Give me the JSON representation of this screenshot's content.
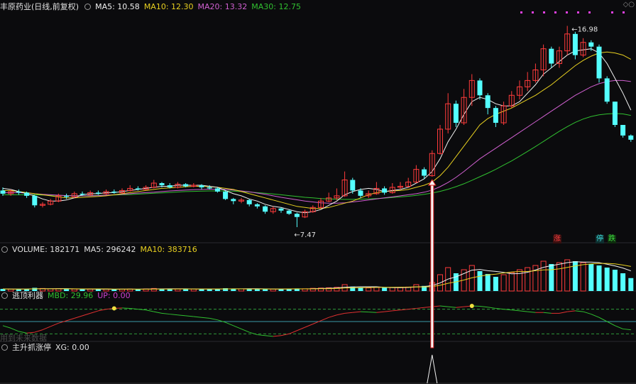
{
  "header": {
    "title": "丰原药业(日线,前复权)",
    "ma_labels": [
      {
        "text": "MA5: 10.58",
        "color": "#f0f0f0"
      },
      {
        "text": "MA10: 12.30",
        "color": "#e8d020"
      },
      {
        "text": "MA20: 13.32",
        "color": "#d060d0"
      },
      {
        "text": "MA30: 12.75",
        "color": "#30c030"
      }
    ]
  },
  "volume_header": {
    "label": "VOLUME: 182171",
    "ma5": "MA5: 296242",
    "ma10": "MA10: 383716"
  },
  "indicator1_header": {
    "name": "逃顶利器",
    "mbd": "MBD: 29.96",
    "up": "UP: 0.00"
  },
  "indicator2_header": {
    "name": "主升抓涨停",
    "xg": "XG: 0.00"
  },
  "watermark": "用到未来数据",
  "annotations": {
    "high": "16.98",
    "low": "7.47"
  },
  "tags": {
    "zhang": "涨",
    "ting": "停",
    "die": "跌"
  },
  "colors": {
    "up": "#ff3b3b",
    "down": "#54ffff",
    "ma5": "#f0f0f0",
    "ma10": "#e8d020",
    "ma20": "#d060d0",
    "ma30": "#30c030"
  },
  "chart_data": {
    "type": "candlestick",
    "price_ylim": [
      7.0,
      17.6
    ],
    "high": {
      "value": 16.98,
      "index": 71
    },
    "low": {
      "value": 7.47,
      "index": 37
    },
    "signal_index": 54,
    "candles": [
      [
        9.2,
        9.05,
        9.35,
        8.95
      ],
      [
        9.05,
        9.15,
        9.25,
        8.95
      ],
      [
        9.15,
        9.1,
        9.25,
        9.0
      ],
      [
        9.1,
        8.95,
        9.15,
        8.85
      ],
      [
        8.95,
        8.5,
        9.0,
        8.4
      ],
      [
        8.5,
        8.55,
        8.65,
        8.4
      ],
      [
        8.55,
        8.7,
        8.8,
        8.5
      ],
      [
        8.7,
        8.95,
        9.05,
        8.65
      ],
      [
        8.95,
        8.9,
        9.05,
        8.8
      ],
      [
        8.9,
        9.05,
        9.15,
        8.85
      ],
      [
        9.05,
        9.0,
        9.15,
        8.95
      ],
      [
        9.0,
        9.1,
        9.2,
        8.95
      ],
      [
        9.1,
        9.05,
        9.2,
        9.0
      ],
      [
        9.05,
        9.15,
        9.25,
        9.0
      ],
      [
        9.15,
        9.1,
        9.25,
        9.05
      ],
      [
        9.1,
        9.2,
        9.3,
        9.05
      ],
      [
        9.2,
        9.3,
        9.45,
        9.15
      ],
      [
        9.3,
        9.25,
        9.4,
        9.2
      ],
      [
        9.25,
        9.35,
        9.45,
        9.2
      ],
      [
        9.35,
        9.55,
        9.7,
        9.3
      ],
      [
        9.55,
        9.45,
        9.6,
        9.35
      ],
      [
        9.45,
        9.35,
        9.55,
        9.3
      ],
      [
        9.35,
        9.5,
        9.6,
        9.3
      ],
      [
        9.5,
        9.4,
        9.55,
        9.35
      ],
      [
        9.4,
        9.45,
        9.55,
        9.35
      ],
      [
        9.45,
        9.35,
        9.5,
        9.25
      ],
      [
        9.35,
        9.3,
        9.45,
        9.25
      ],
      [
        9.3,
        9.15,
        9.35,
        9.1
      ],
      [
        9.15,
        8.8,
        9.2,
        8.75
      ],
      [
        8.8,
        8.7,
        8.85,
        8.55
      ],
      [
        8.7,
        8.75,
        8.85,
        8.6
      ],
      [
        8.75,
        8.55,
        8.8,
        8.45
      ],
      [
        8.55,
        8.45,
        8.6,
        8.35
      ],
      [
        8.45,
        8.2,
        8.5,
        8.1
      ],
      [
        8.2,
        8.35,
        8.45,
        8.1
      ],
      [
        8.35,
        8.25,
        8.4,
        8.15
      ],
      [
        8.25,
        8.1,
        8.3,
        8.05
      ],
      [
        8.1,
        7.95,
        8.15,
        7.47
      ],
      [
        7.95,
        8.2,
        8.3,
        7.9
      ],
      [
        8.2,
        8.4,
        8.5,
        8.15
      ],
      [
        8.4,
        8.7,
        8.85,
        8.35
      ],
      [
        8.7,
        8.85,
        9.1,
        8.65
      ],
      [
        8.85,
        8.95,
        9.3,
        8.75
      ],
      [
        8.95,
        9.7,
        10.1,
        8.9
      ],
      [
        9.7,
        9.2,
        9.8,
        9.05
      ],
      [
        9.2,
        8.95,
        9.3,
        8.85
      ],
      [
        8.95,
        9.05,
        9.2,
        8.85
      ],
      [
        9.05,
        9.3,
        9.6,
        9.0
      ],
      [
        9.3,
        9.1,
        9.4,
        9.0
      ],
      [
        9.1,
        9.35,
        9.55,
        9.05
      ],
      [
        9.35,
        9.4,
        9.6,
        9.25
      ],
      [
        9.4,
        9.6,
        9.8,
        9.35
      ],
      [
        9.6,
        10.2,
        10.4,
        9.55
      ],
      [
        10.2,
        9.9,
        10.3,
        9.75
      ],
      [
        9.9,
        10.95,
        11.1,
        9.85
      ],
      [
        10.95,
        12.1,
        12.3,
        10.9
      ],
      [
        12.1,
        13.3,
        13.8,
        11.9
      ],
      [
        13.3,
        12.4,
        13.45,
        12.2
      ],
      [
        12.4,
        13.6,
        14.0,
        12.3
      ],
      [
        13.6,
        14.4,
        14.7,
        13.2
      ],
      [
        14.4,
        13.7,
        14.5,
        13.5
      ],
      [
        13.7,
        13.1,
        13.8,
        12.8
      ],
      [
        13.1,
        12.4,
        13.2,
        12.2
      ],
      [
        12.4,
        13.2,
        13.4,
        12.3
      ],
      [
        13.2,
        13.7,
        13.9,
        13.1
      ],
      [
        13.7,
        14.1,
        14.4,
        13.5
      ],
      [
        14.1,
        14.4,
        14.8,
        13.9
      ],
      [
        14.4,
        14.9,
        15.2,
        14.3
      ],
      [
        14.9,
        15.9,
        16.1,
        14.6
      ],
      [
        15.9,
        15.2,
        16.0,
        15.0
      ],
      [
        15.2,
        15.8,
        16.0,
        15.0
      ],
      [
        15.8,
        16.6,
        16.98,
        15.6
      ],
      [
        16.6,
        15.6,
        16.7,
        15.4
      ],
      [
        15.6,
        16.2,
        16.4,
        15.5
      ],
      [
        16.2,
        16.0,
        16.3,
        15.8
      ],
      [
        16.0,
        14.5,
        16.1,
        14.3
      ],
      [
        14.5,
        13.4,
        14.6,
        13.3
      ],
      [
        13.4,
        12.3,
        13.4,
        12.2
      ],
      [
        12.3,
        11.8,
        12.3,
        11.7
      ],
      [
        11.8,
        11.6,
        11.85,
        11.5
      ]
    ],
    "ma": {
      "ma5": [
        9.3,
        9.25,
        9.15,
        9.05,
        8.95,
        8.8,
        8.7,
        8.7,
        8.75,
        8.85,
        9.0,
        9.05,
        9.05,
        9.1,
        9.1,
        9.15,
        9.2,
        9.25,
        9.3,
        9.35,
        9.4,
        9.4,
        9.45,
        9.45,
        9.45,
        9.45,
        9.4,
        9.35,
        9.2,
        9.05,
        8.95,
        8.8,
        8.7,
        8.55,
        8.45,
        8.4,
        8.3,
        8.2,
        8.15,
        8.2,
        8.3,
        8.5,
        8.7,
        9.0,
        9.15,
        9.25,
        9.3,
        9.25,
        9.15,
        9.2,
        9.25,
        9.35,
        9.55,
        9.75,
        10.1,
        10.7,
        11.5,
        12.1,
        12.8,
        13.4,
        13.6,
        13.5,
        13.3,
        13.2,
        13.2,
        13.4,
        13.8,
        14.2,
        14.7,
        15.0,
        15.3,
        15.6,
        15.8,
        15.85,
        15.9,
        15.7,
        15.2,
        14.5,
        13.8,
        13.0
      ],
      "ma10": [
        9.2,
        9.2,
        9.15,
        9.1,
        9.05,
        9.0,
        8.95,
        8.9,
        8.85,
        8.85,
        8.88,
        8.9,
        8.92,
        8.95,
        9.0,
        9.05,
        9.1,
        9.15,
        9.2,
        9.25,
        9.3,
        9.32,
        9.35,
        9.38,
        9.4,
        9.4,
        9.38,
        9.35,
        9.3,
        9.25,
        9.15,
        9.05,
        8.95,
        8.85,
        8.75,
        8.65,
        8.55,
        8.45,
        8.4,
        8.35,
        8.35,
        8.4,
        8.5,
        8.6,
        8.7,
        8.85,
        9.0,
        9.1,
        9.15,
        9.18,
        9.2,
        9.25,
        9.35,
        9.45,
        9.6,
        9.9,
        10.3,
        10.8,
        11.3,
        11.8,
        12.3,
        12.6,
        12.8,
        12.95,
        13.1,
        13.3,
        13.5,
        13.7,
        13.95,
        14.2,
        14.5,
        14.8,
        15.1,
        15.35,
        15.55,
        15.7,
        15.75,
        15.7,
        15.6,
        15.4
      ],
      "ma20": [
        9.1,
        9.1,
        9.1,
        9.08,
        9.05,
        9.02,
        9.0,
        8.98,
        8.96,
        8.95,
        8.95,
        8.95,
        8.96,
        8.98,
        9.0,
        9.02,
        9.05,
        9.08,
        9.1,
        9.12,
        9.15,
        9.18,
        9.2,
        9.22,
        9.24,
        9.25,
        9.26,
        9.26,
        9.25,
        9.22,
        9.18,
        9.14,
        9.08,
        9.02,
        8.95,
        8.88,
        8.82,
        8.76,
        8.7,
        8.66,
        8.62,
        8.6,
        8.6,
        8.62,
        8.66,
        8.7,
        8.75,
        8.8,
        8.85,
        8.9,
        8.95,
        9.0,
        9.05,
        9.12,
        9.22,
        9.38,
        9.58,
        9.82,
        10.1,
        10.4,
        10.7,
        10.95,
        11.2,
        11.45,
        11.7,
        11.95,
        12.2,
        12.45,
        12.7,
        12.95,
        13.2,
        13.45,
        13.7,
        13.9,
        14.1,
        14.25,
        14.35,
        14.4,
        14.4,
        14.35
      ],
      "ma30": [
        9.0,
        9.0,
        9.0,
        9.0,
        9.0,
        8.99,
        8.98,
        8.97,
        8.96,
        8.96,
        8.96,
        8.96,
        8.97,
        8.98,
        8.99,
        9.0,
        9.01,
        9.03,
        9.05,
        9.07,
        9.09,
        9.11,
        9.13,
        9.15,
        9.16,
        9.17,
        9.18,
        9.18,
        9.18,
        9.17,
        9.15,
        9.13,
        9.1,
        9.07,
        9.04,
        9.0,
        8.96,
        8.92,
        8.88,
        8.85,
        8.82,
        8.8,
        8.79,
        8.78,
        8.78,
        8.79,
        8.8,
        8.82,
        8.84,
        8.87,
        8.9,
        8.93,
        8.97,
        9.02,
        9.08,
        9.16,
        9.26,
        9.38,
        9.52,
        9.68,
        9.85,
        10.02,
        10.2,
        10.4,
        10.6,
        10.82,
        11.05,
        11.28,
        11.52,
        11.76,
        12.0,
        12.22,
        12.42,
        12.58,
        12.7,
        12.78,
        12.82,
        12.84,
        12.82,
        12.75
      ]
    },
    "volume_ylim": [
      0,
      500000
    ],
    "volume": [
      30000,
      26000,
      24000,
      28000,
      45000,
      36000,
      30000,
      32000,
      26000,
      28000,
      24000,
      26000,
      25000,
      27000,
      24000,
      26000,
      28000,
      26000,
      30000,
      36000,
      32000,
      30000,
      28000,
      27000,
      28000,
      26000,
      25000,
      28000,
      40000,
      34000,
      30000,
      28000,
      26000,
      30000,
      28000,
      26000,
      30000,
      36000,
      32000,
      38000,
      42000,
      46000,
      52000,
      90000,
      62000,
      50000,
      44000,
      52000,
      46000,
      50000,
      48000,
      56000,
      90000,
      72000,
      120000,
      230000,
      330000,
      250000,
      300000,
      360000,
      280000,
      240000,
      200000,
      230000,
      260000,
      300000,
      330000,
      360000,
      420000,
      380000,
      400000,
      440000,
      420000,
      400000,
      380000,
      360000,
      330000,
      300000,
      250000,
      182171
    ],
    "indicator1_ylim": [
      0,
      100
    ],
    "indicator1_levels": [
      80,
      50,
      20
    ],
    "mbd": [
      40,
      34,
      26,
      22,
      24,
      30,
      38,
      46,
      52,
      58,
      64,
      70,
      76,
      80,
      82,
      83,
      82,
      80,
      78,
      74,
      70,
      68,
      66,
      64,
      62,
      60,
      58,
      54,
      48,
      40,
      32,
      24,
      18,
      16,
      14,
      16,
      20,
      28,
      36,
      44,
      52,
      60,
      66,
      70,
      72,
      74,
      73,
      72,
      74,
      76,
      78,
      80,
      82,
      84,
      86,
      88,
      86,
      84,
      86,
      88,
      87,
      85,
      82,
      80,
      78,
      76,
      74,
      72,
      72,
      70,
      70,
      74,
      76,
      74,
      68,
      60,
      50,
      40,
      32,
      29.96
    ],
    "mbd_markers": [
      14,
      59
    ],
    "xg": [
      0,
      0,
      0,
      0,
      0,
      0,
      0,
      0,
      0,
      0,
      0,
      0,
      0,
      0,
      0,
      0,
      0,
      0,
      0,
      0,
      0,
      0,
      0,
      0,
      0,
      0,
      0,
      0,
      0,
      0,
      0,
      0,
      0,
      0,
      0,
      0,
      0,
      0,
      0,
      0,
      0,
      0,
      0,
      0,
      0,
      0,
      0,
      0,
      0,
      0,
      0,
      0,
      0,
      0,
      1,
      0,
      0,
      0,
      0,
      0,
      0,
      0,
      0,
      0,
      0,
      0,
      0,
      0,
      0,
      0,
      0,
      0,
      0,
      0,
      0,
      0,
      0,
      0,
      0,
      0
    ]
  }
}
